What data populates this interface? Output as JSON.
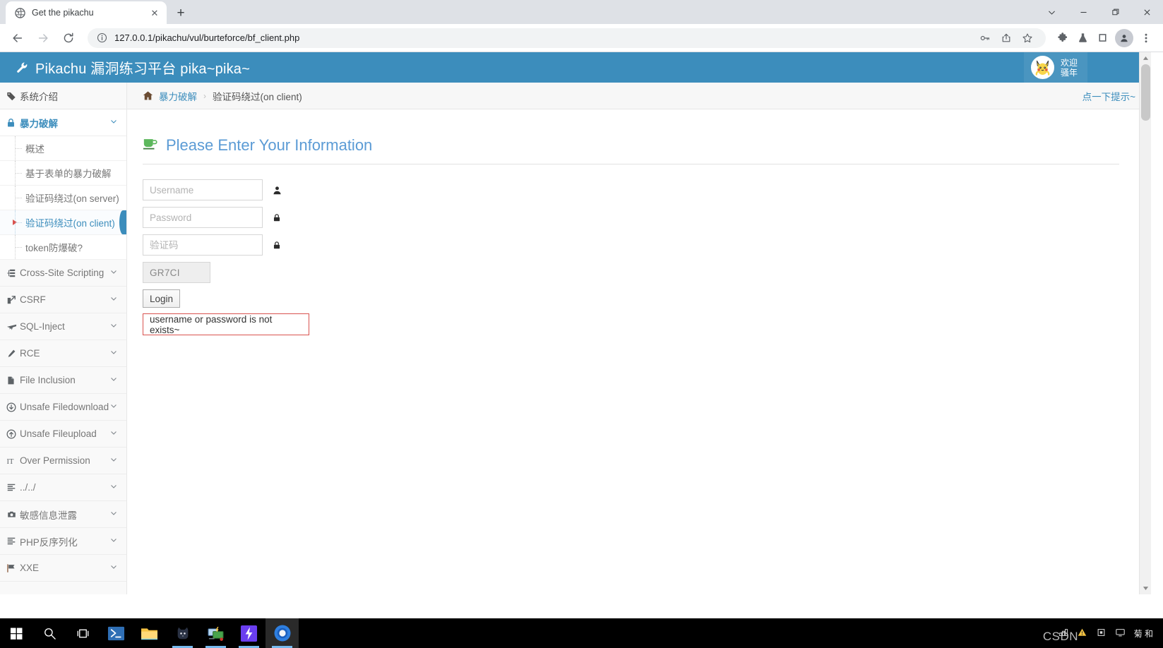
{
  "browser": {
    "tab_title": "Get the pikachu",
    "tab_close": "✕",
    "new_tab": "+",
    "url": "127.0.0.1/pikachu/vul/burteforce/bf_client.php",
    "window_controls": [
      "∨",
      "—",
      "❐",
      "✕"
    ],
    "toolbar_icons": [
      "back-arrow",
      "forward-arrow",
      "reload",
      "info-circle",
      "password-key",
      "share",
      "bookmark-star",
      "extensions-puzzle",
      "experiments-flask",
      "split-screen",
      "profile-avatar",
      "three-dot-menu"
    ]
  },
  "site": {
    "brand": "Pikachu 漏洞练习平台 pika~pika~",
    "brand_icon": "wrench-icon",
    "greet_line1": "欢迎",
    "greet_line2": "骚年"
  },
  "sidebar": {
    "intro": {
      "label": "系统介绍",
      "icon": "tag-icon"
    },
    "groups": [
      {
        "label": "暴力破解",
        "icon": "lock-icon",
        "caret": "⌄",
        "active": true,
        "items": [
          {
            "label": "概述",
            "current": false
          },
          {
            "label": "基于表单的暴力破解",
            "current": false
          },
          {
            "label": "验证码绕过(on server)",
            "current": false
          },
          {
            "label": "验证码绕过(on client)",
            "current": true
          },
          {
            "label": "token防爆破?",
            "current": false
          }
        ]
      },
      {
        "label": "Cross-Site Scripting",
        "icon": "sitemap-icon",
        "caret": "⌄"
      },
      {
        "label": "CSRF",
        "icon": "external-link-icon",
        "caret": "⌄"
      },
      {
        "label": "SQL-Inject",
        "icon": "plane-icon",
        "caret": "⌄"
      },
      {
        "label": "RCE",
        "icon": "pencil-icon",
        "caret": "⌄"
      },
      {
        "label": "File Inclusion",
        "icon": "file-icon",
        "caret": "⌄"
      },
      {
        "label": "Unsafe Filedownload",
        "icon": "download-circle-icon",
        "caret": "⌄"
      },
      {
        "label": "Unsafe Fileupload",
        "icon": "upload-circle-icon",
        "caret": "⌄"
      },
      {
        "label": "Over Permission",
        "icon": "text-height-icon",
        "caret": "⌄"
      },
      {
        "label": "../../",
        "icon": "align-left-icon",
        "caret": "⌄"
      },
      {
        "label": "敏感信息泄露",
        "icon": "camera-icon",
        "caret": "⌄"
      },
      {
        "label": "PHP反序列化",
        "icon": "align-left-icon",
        "caret": "⌄"
      },
      {
        "label": "XXE",
        "icon": "flag-icon",
        "caret": "⌄"
      }
    ]
  },
  "breadcrumb": {
    "home_icon": "home-icon",
    "parent": "暴力破解",
    "separator": "›",
    "current": "验证码绕过(on client)",
    "hint": "点一下提示~"
  },
  "panel": {
    "title": "Please Enter Your Information",
    "title_icon": "coffee-cup-icon",
    "fields": [
      {
        "name": "username",
        "placeholder": "Username",
        "value": "",
        "icon": "user-icon",
        "type": "text"
      },
      {
        "name": "password",
        "placeholder": "Password",
        "value": "",
        "icon": "lock-icon",
        "type": "password"
      },
      {
        "name": "captcha",
        "placeholder": "验证码",
        "value": "",
        "icon": "lock-icon",
        "type": "text"
      }
    ],
    "captcha_code": "GR7CI",
    "login_label": "Login",
    "error_message": "username or password is not exists~",
    "error_color": "#d9534f"
  },
  "taskbar": {
    "items": [
      {
        "icon": "windows-start-icon",
        "running": false,
        "active": false
      },
      {
        "icon": "search-icon",
        "running": false,
        "active": false
      },
      {
        "icon": "task-view-icon",
        "running": false,
        "active": false
      },
      {
        "icon": "powershell-icon",
        "running": false,
        "active": false
      },
      {
        "icon": "file-explorer-icon",
        "running": false,
        "active": false
      },
      {
        "icon": "cat-terminal-icon",
        "running": true,
        "active": false
      },
      {
        "icon": "remote-desktop-icon",
        "running": true,
        "active": false
      },
      {
        "icon": "lightning-app-icon",
        "running": true,
        "active": false
      },
      {
        "icon": "chrome-icon",
        "running": true,
        "active": true
      }
    ],
    "watermark": "CSDN",
    "tray_icons": [
      "network-icon",
      "warning-icon",
      "usb-icon",
      "screen-icon"
    ],
    "tray_text": "菊 和"
  },
  "colors": {
    "header_blue": "#3c8dbc",
    "accent_link": "#3c8dbc",
    "error_red": "#d9534f",
    "sidebar_bg": "#f9f9f9"
  }
}
